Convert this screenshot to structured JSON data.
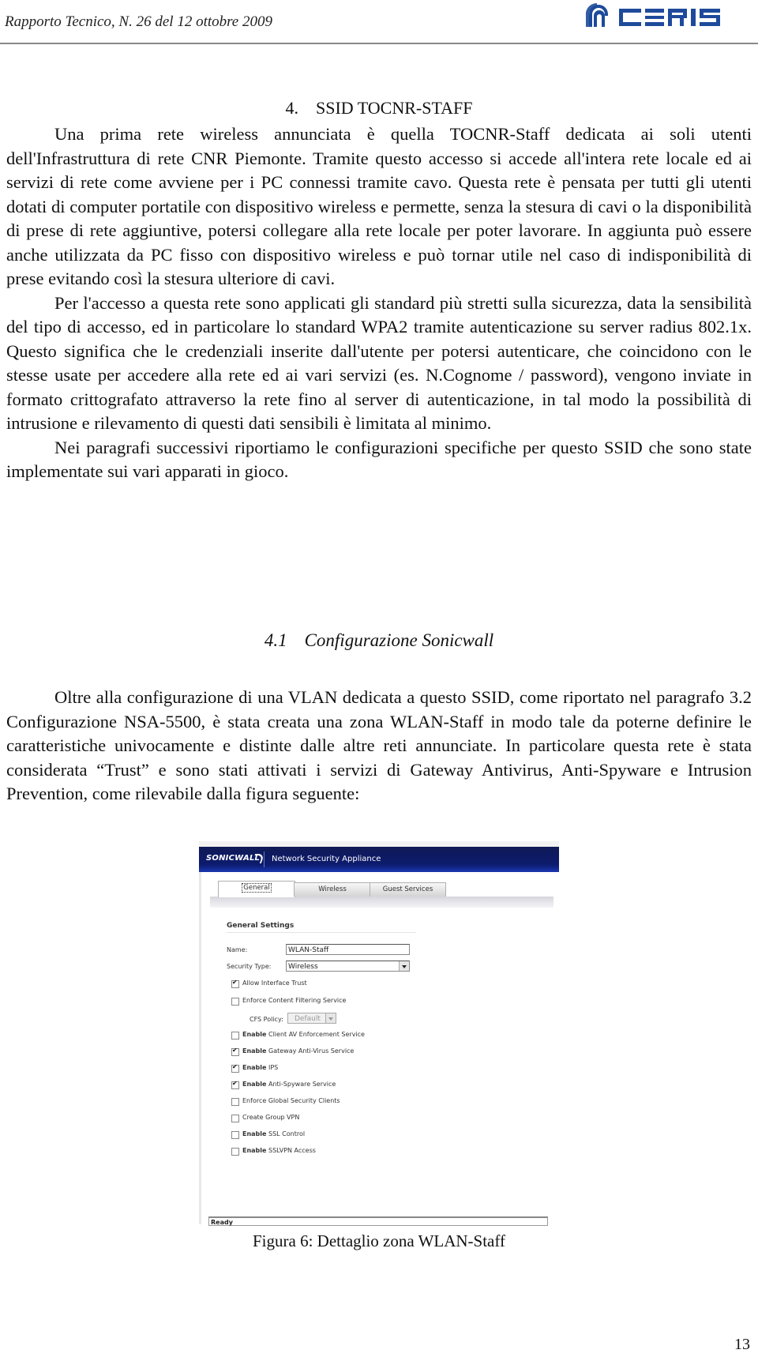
{
  "header": {
    "title": "Rapporto Tecnico, N. 26 del 12 ottobre 2009",
    "logo_text": "CERIS",
    "logo_color": "#1d4a9b"
  },
  "section": {
    "number": "4.",
    "title": "SSID TOCNR-STAFF"
  },
  "paragraphs": [
    "Una prima rete wireless annunciata è quella TOCNR-Staff dedicata ai soli utenti dell'Infrastruttura di rete CNR Piemonte. Tramite questo accesso si accede all'intera rete locale ed ai servizi di rete come avviene per i PC connessi tramite cavo. Questa rete è pensata per tutti gli utenti dotati di computer portatile con dispositivo wireless e permette, senza la stesura di cavi o la disponibilità di prese di rete aggiuntive, potersi collegare alla rete locale per poter lavorare. In aggiunta può essere anche utilizzata da PC fisso con dispositivo wireless e può tornar utile nel caso di indisponibilità di prese evitando così la stesura ulteriore di cavi.",
    "Per l'accesso a questa rete sono applicati gli standard più stretti sulla sicurezza, data la sensibilità del tipo di accesso, ed in particolare lo standard WPA2 tramite autenticazione su server radius 802.1x. Questo significa che le credenziali inserite dall'utente per potersi autenticare, che coincidono con le stesse usate per accedere alla rete ed ai vari servizi (es. N.Cognome / password), vengono inviate in formato crittografato attraverso la rete fino al server di autenticazione, in tal modo la possibilità di intrusione e rilevamento di questi dati sensibili è limitata al minimo.",
    "Nei paragrafi successivi riportiamo le configurazioni specifiche per questo SSID che sono state implementate sui vari apparati in gioco."
  ],
  "subsection": {
    "number": "4.1",
    "title": "Configurazione Sonicwall"
  },
  "subsection_paragraphs": [
    "Oltre alla configurazione di una VLAN dedicata a questo SSID, come riportato nel paragrafo 3.2 Configurazione NSA-5500, è stata creata una zona WLAN-Staff in modo tale da poterne definire le caratteristiche univocamente e distinte dalle altre reti annunciate. In particolare questa rete è stata considerata “Trust” e sono stati attivati i servizi di Gateway Antivirus, Anti-Spyware e Intrusion Prevention, come rilevabile dalla figura seguente:"
  ],
  "figure": {
    "brand": "SONICWALL",
    "app_title": "Network Security Appliance",
    "tabs": [
      {
        "label": "General",
        "active": true
      },
      {
        "label": "Wireless",
        "active": false
      },
      {
        "label": "Guest Services",
        "active": false
      }
    ],
    "section_title": "General Settings",
    "name_label": "Name:",
    "name_value": "WLAN-Staff",
    "security_type_label": "Security Type:",
    "security_type_value": "Wireless",
    "cfs_policy_label": "CFS Policy:",
    "cfs_policy_value": "Default",
    "checkboxes": [
      {
        "prefix": "",
        "label": "Allow Interface Trust",
        "checked": true
      },
      {
        "prefix": "",
        "label": "Enforce Content Filtering Service",
        "checked": false
      },
      {
        "prefix": "Enable",
        "label": " Client AV Enforcement Service",
        "checked": false
      },
      {
        "prefix": "Enable",
        "label": " Gateway Anti-Virus Service",
        "checked": true
      },
      {
        "prefix": "Enable",
        "label": " IPS",
        "checked": true
      },
      {
        "prefix": "Enable",
        "label": " Anti-Spyware Service",
        "checked": true
      },
      {
        "prefix": "",
        "label": "Enforce Global Security Clients",
        "checked": false
      },
      {
        "prefix": "",
        "label": "Create Group VPN",
        "checked": false
      },
      {
        "prefix": "Enable",
        "label": " SSL Control",
        "checked": false
      },
      {
        "prefix": "Enable",
        "label": " SSLVPN Access",
        "checked": false
      }
    ],
    "status": "Ready",
    "header_color": "#0d1b6e"
  },
  "caption": "Figura 6: Dettaglio zona WLAN-Staff",
  "page_number": "13"
}
